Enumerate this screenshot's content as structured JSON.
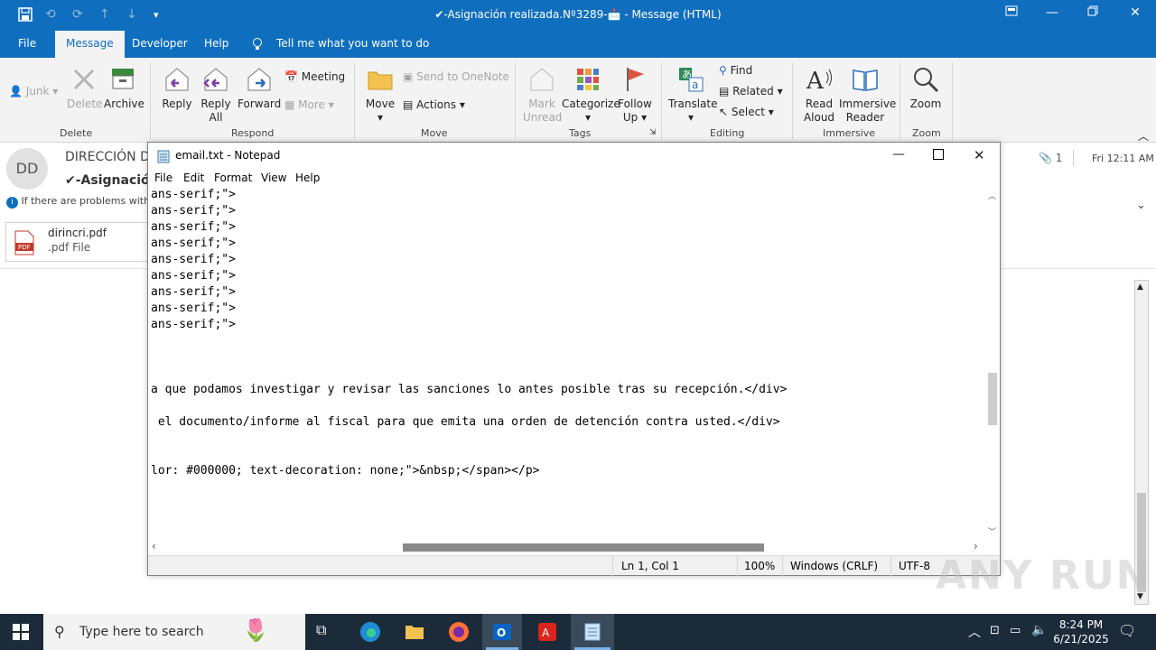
{
  "window": {
    "title": "✔-Asignación realizada.Nº3289-📩 - Message (HTML)"
  },
  "menu": {
    "tabs": [
      "File",
      "Message",
      "Developer",
      "Help"
    ],
    "tell_me": "Tell me what you want to do"
  },
  "ribbon": {
    "junk": "Junk",
    "delete": "Delete",
    "archive": "Archive",
    "reply": "Reply",
    "reply_all_1": "Reply",
    "reply_all_2": "All",
    "forward": "Forward",
    "meeting": "Meeting",
    "more": "More",
    "move": "Move",
    "send_onenote": "Send to OneNote",
    "actions": "Actions",
    "mark_unread_1": "Mark",
    "mark_unread_2": "Unread",
    "categorize": "Categorize",
    "follow_up_1": "Follow",
    "follow_up_2": "Up",
    "translate": "Translate",
    "find": "Find",
    "related": "Related",
    "select": "Select",
    "read_aloud_1": "Read",
    "read_aloud_2": "Aloud",
    "immersive_1": "Immersive",
    "immersive_2": "Reader",
    "zoom": "Zoom",
    "groups": {
      "delete": "Delete",
      "respond": "Respond",
      "move": "Move",
      "tags": "Tags",
      "editing": "Editing",
      "immersive": "Immersive",
      "zoom": "Zoom"
    }
  },
  "message": {
    "avatar_initials": "DD",
    "sender": "DIRECCIÓN D",
    "subject": "✔-Asignación",
    "info_bar": "If there are problems with",
    "attachment_count": "1",
    "date": "Fri 12:11 AM",
    "attachment_name": "dirincri.pdf",
    "attachment_type": ".pdf File"
  },
  "notepad": {
    "title": "email.txt - Notepad",
    "menu": [
      "File",
      "Edit",
      "Format",
      "View",
      "Help"
    ],
    "lines": [
      "ans-serif;\">",
      "ans-serif;\">",
      "ans-serif;\">",
      "ans-serif;\">",
      "ans-serif;\">",
      "ans-serif;\">",
      "ans-serif;\">",
      "ans-serif;\">",
      "ans-serif;\">",
      "",
      "",
      "",
      "a que podamos investigar y revisar las sanciones lo antes posible tras su recepción.</div>",
      "",
      " el documento/informe al fiscal para que emita una orden de detención contra usted.</div>",
      "",
      "",
      "lor: #000000; text-decoration: none;\">&nbsp;</span></p>"
    ],
    "status": {
      "position": "Ln 1, Col 1",
      "zoom": "100%",
      "line_ending": "Windows (CRLF)",
      "encoding": "UTF-8"
    }
  },
  "taskbar": {
    "search_placeholder": "Type here to search",
    "time": "8:24 PM",
    "date": "6/21/2025"
  },
  "watermark": "ANY RUN"
}
